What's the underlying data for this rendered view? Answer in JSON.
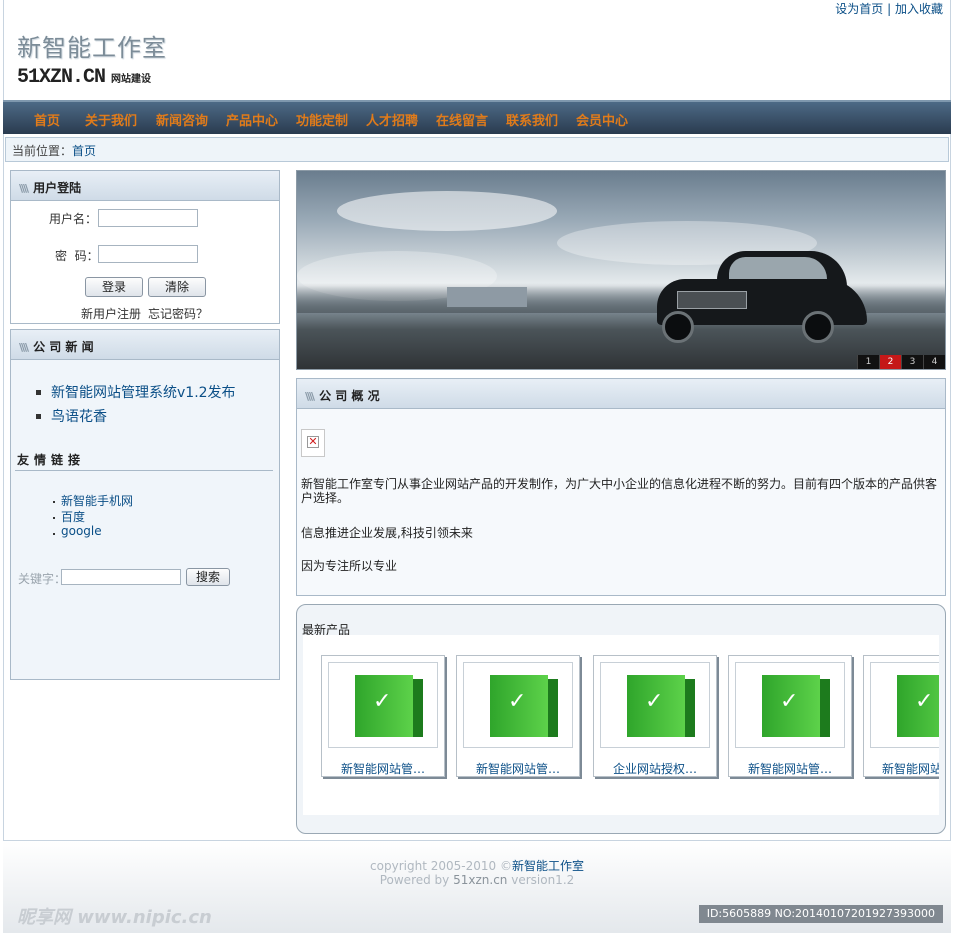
{
  "header": {
    "links": [
      "设为首页",
      "加入收藏"
    ],
    "separator": "|",
    "title": "新智能工作室",
    "domain": "51XZN.CN",
    "tagline": "网站建设"
  },
  "nav": [
    "首页",
    "关于我们",
    "新闻咨询",
    "产品中心",
    "功能定制",
    "人才招聘",
    "在线留言",
    "联系我们",
    "会员中心"
  ],
  "breadcrumb": {
    "label": "当前位置：",
    "current": "首页"
  },
  "login": {
    "title": "用户登陆",
    "username_label": "用户名：",
    "password_label": "密  码：",
    "login_button": "登录",
    "clear_button": "清除",
    "register_link": "新用户注册",
    "forgot_link": "忘记密码？"
  },
  "news": {
    "title": "公 司 新 闻",
    "items": [
      "新智能网站管理系统v1.2发布",
      "鸟语花香"
    ]
  },
  "friend_links": {
    "title": "友情链接",
    "items": [
      "新智能手机网",
      "百度",
      "google"
    ]
  },
  "search": {
    "label": "关键字：",
    "button": "搜索"
  },
  "banner": {
    "pages": [
      "1",
      "2",
      "3",
      "4"
    ],
    "active_page": "2"
  },
  "overview": {
    "title": "公 司 概 况",
    "paragraphs": [
      "新智能工作室专门从事企业网站产品的开发制作，为广大中小企业的信息化进程不断的努力。目前有四个版本的产品供客户选择。",
      "信息推进企业发展,科技引领未来",
      "因为专注所以专业"
    ]
  },
  "products": {
    "title": "最新产品",
    "items": [
      "新智能网站管…",
      "新智能网站管…",
      "企业网站授权…",
      "新智能网站管…",
      "新智能网站"
    ]
  },
  "footer": {
    "copyright_prefix": "copyright 2005-2010 ©",
    "copyright_name": "新智能工作室",
    "powered_prefix": "Powered by",
    "powered_site": "51xzn.cn",
    "version": "version1.2",
    "watermark": "昵享网 www.nipic.cn",
    "image_id": "ID:5605889 NO:20140107201927393000"
  }
}
